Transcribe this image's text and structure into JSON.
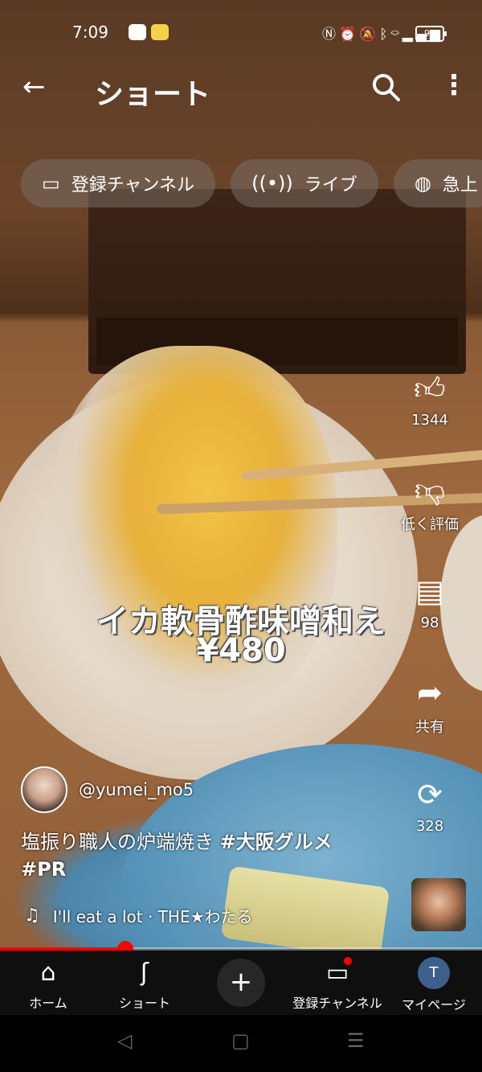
{
  "status_bar": {
    "time": "7:09",
    "app_icons": [
      "line-icon",
      "news-app-icon"
    ],
    "system_icons": [
      "nfc-icon",
      "alarm-icon",
      "mute-icon",
      "bluetooth-icon",
      "wifi-icon",
      "volte-icon",
      "signal-icon"
    ],
    "battery": "93"
  },
  "header": {
    "title": "ショート"
  },
  "chips": [
    {
      "icon": "subscriptions-icon",
      "label": "登録チャンネル"
    },
    {
      "icon": "live-icon",
      "label": "ライブ"
    },
    {
      "icon": "trending-icon",
      "label": "急上"
    }
  ],
  "video_overlay": {
    "line1": "イカ軟骨酢味噌和え",
    "line2": "¥480"
  },
  "actions": {
    "like_count": "1344",
    "dislike_label": "低く評価",
    "comment_count": "98",
    "share_label": "共有",
    "remix_count": "328"
  },
  "channel": {
    "handle": "@yumei_mo5"
  },
  "caption": {
    "text": "塩振り職人の炉端焼き ",
    "hashtag1": "#大阪グルメ",
    "hashtag2": "#PR"
  },
  "music": {
    "text": "I'll eat a lot · THE★わたる"
  },
  "progress": {
    "fraction": 0.26
  },
  "bottom_nav": [
    {
      "icon": "home-icon",
      "label": "ホーム"
    },
    {
      "icon": "shorts-icon",
      "label": "ショート"
    },
    {
      "icon": "create-icon",
      "label": ""
    },
    {
      "icon": "subscriptions-icon",
      "label": "登録チャンネル"
    },
    {
      "icon": "avatar",
      "label": "マイページ",
      "avatar_letter": "T"
    }
  ],
  "colors": {
    "accent": "#ff0000",
    "nav_bg": "#0f0f0f"
  }
}
